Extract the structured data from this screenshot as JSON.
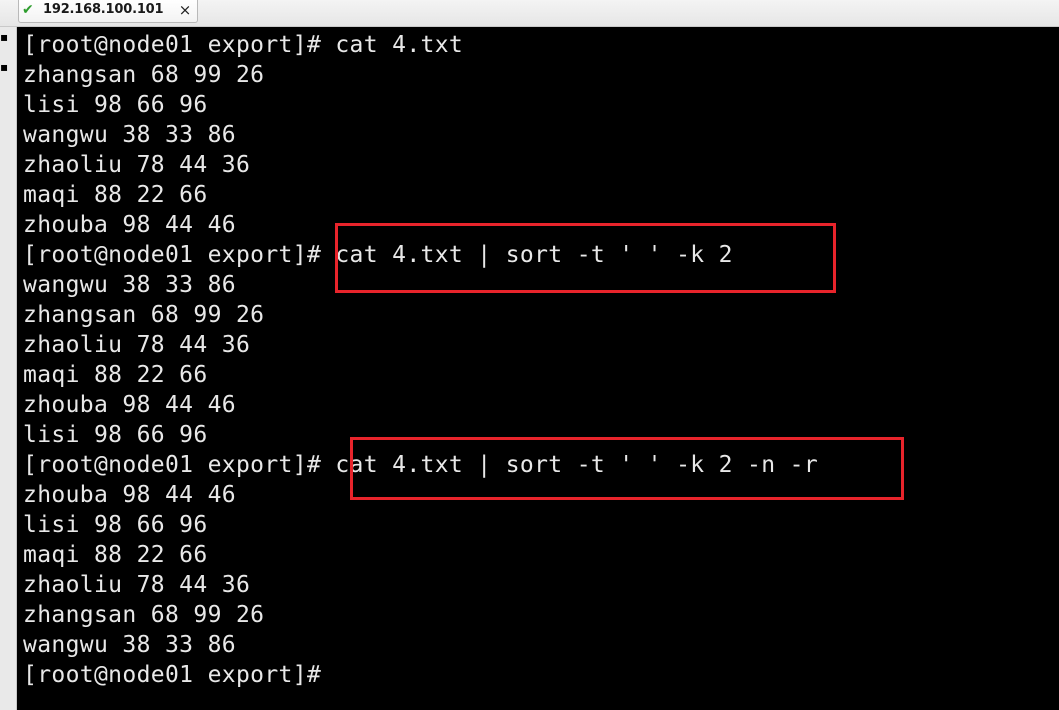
{
  "tab": {
    "title": "192.168.100.101",
    "check_icon": "check-icon",
    "close_label": "×"
  },
  "terminal": {
    "lines": [
      "[root@node01 export]# cat 4.txt",
      "zhangsan 68 99 26",
      "lisi 98 66 96",
      "wangwu 38 33 86",
      "zhaoliu 78 44 36",
      "maqi 88 22 66",
      "zhouba 98 44 46",
      "[root@node01 export]# cat 4.txt | sort -t ' ' -k 2",
      "wangwu 38 33 86",
      "zhangsan 68 99 26",
      "zhaoliu 78 44 36",
      "maqi 88 22 66",
      "zhouba 98 44 46",
      "lisi 98 66 96",
      "[root@node01 export]# cat 4.txt | sort -t ' ' -k 2 -n -r",
      "zhouba 98 44 46",
      "lisi 98 66 96",
      "maqi 88 22 66",
      "zhaoliu 78 44 36",
      "zhangsan 68 99 26",
      "wangwu 38 33 86",
      "[root@node01 export]#"
    ]
  },
  "colors": {
    "terminal_bg": "#000000",
    "terminal_fg": "#e8e8e8",
    "highlight": "#e8242b"
  }
}
